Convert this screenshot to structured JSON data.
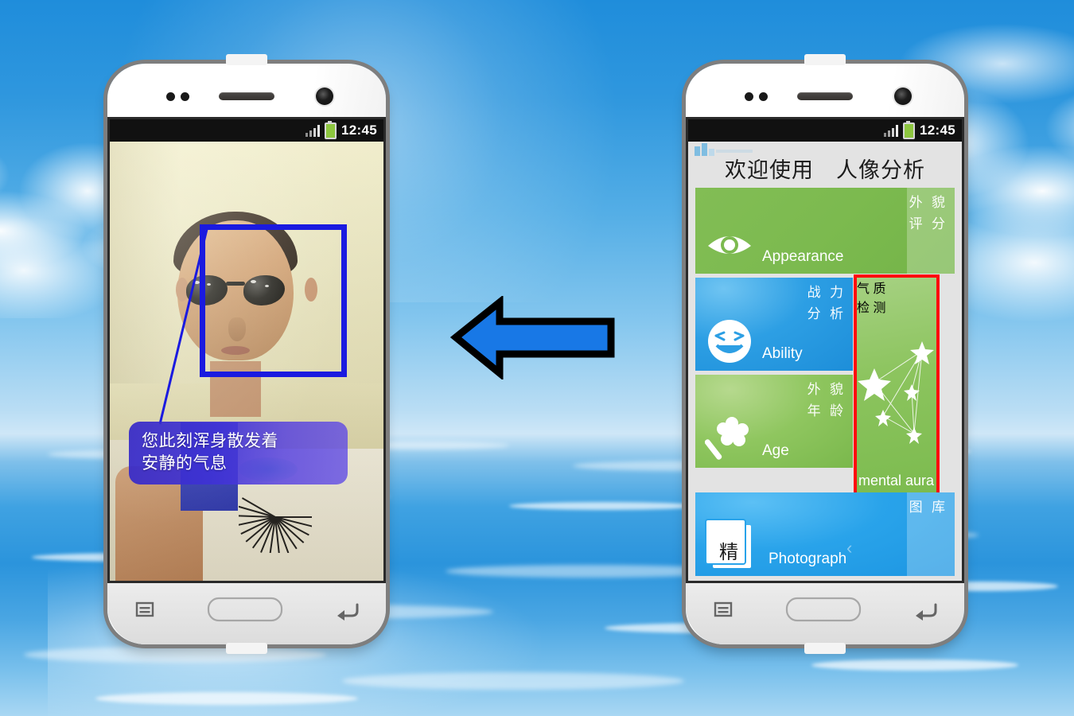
{
  "scene": {
    "background": "sky-clouds-over-water",
    "arrow": {
      "direction": "left",
      "fill": "#1878e6",
      "stroke": "#000000"
    }
  },
  "phone_left": {
    "name": "result-phone",
    "status_bar": {
      "time": "12:45",
      "signal_icon": "signal-bars-icon",
      "battery_icon": "battery-icon",
      "battery_color": "#8dc63f"
    },
    "photo": {
      "face_box": {
        "label": "face-detection-box",
        "color": "#1a1ae0"
      },
      "caption": "您此刻浑身散发着 安静的气息",
      "caption_line1": "您此刻浑身散发着",
      "caption_line2": "安静的气息",
      "caption_bg": "#3528c8"
    },
    "nav": {
      "menu": "menu-key",
      "home": "home-key",
      "back": "back-key"
    }
  },
  "phone_right": {
    "name": "home-phone",
    "status_bar": {
      "time": "12:45",
      "signal_icon": "signal-bars-icon",
      "battery_icon": "battery-icon",
      "battery_color": "#8dc63f"
    },
    "app_title": "欢迎使用　人像分析",
    "tiles": [
      {
        "id": "appearance",
        "en": "Appearance",
        "cn_line1": "外 貌",
        "cn_line2": "评 分",
        "color": "#7cba4f",
        "icon": "eye-icon"
      },
      {
        "id": "ability",
        "en": "Ability",
        "cn_line1": "战 力",
        "cn_line2": "分 析",
        "color": "#2d9fe4",
        "icon": "smiley-face-icon"
      },
      {
        "id": "age",
        "en": "Age",
        "cn_line1": "外 貌",
        "cn_line2": "年 龄",
        "color": "#8fc65f",
        "icon": "magic-wand-icon"
      },
      {
        "id": "mental-aura",
        "en": "mental aura",
        "cn_line1": "气 质",
        "cn_line2": "检 测",
        "color": "#8cc45e",
        "icon": "constellation-stars-icon",
        "highlight": "#ff0b0b",
        "highlighted": true
      },
      {
        "id": "photograph",
        "en": "Photograph",
        "cn_line1": "图 库",
        "cn_line2": "",
        "color": "#29a3ea",
        "icon": "photo-stack-icon",
        "icon_glyph": "精"
      }
    ],
    "nav": {
      "menu": "menu-key",
      "home": "home-key",
      "back": "back-key"
    }
  }
}
